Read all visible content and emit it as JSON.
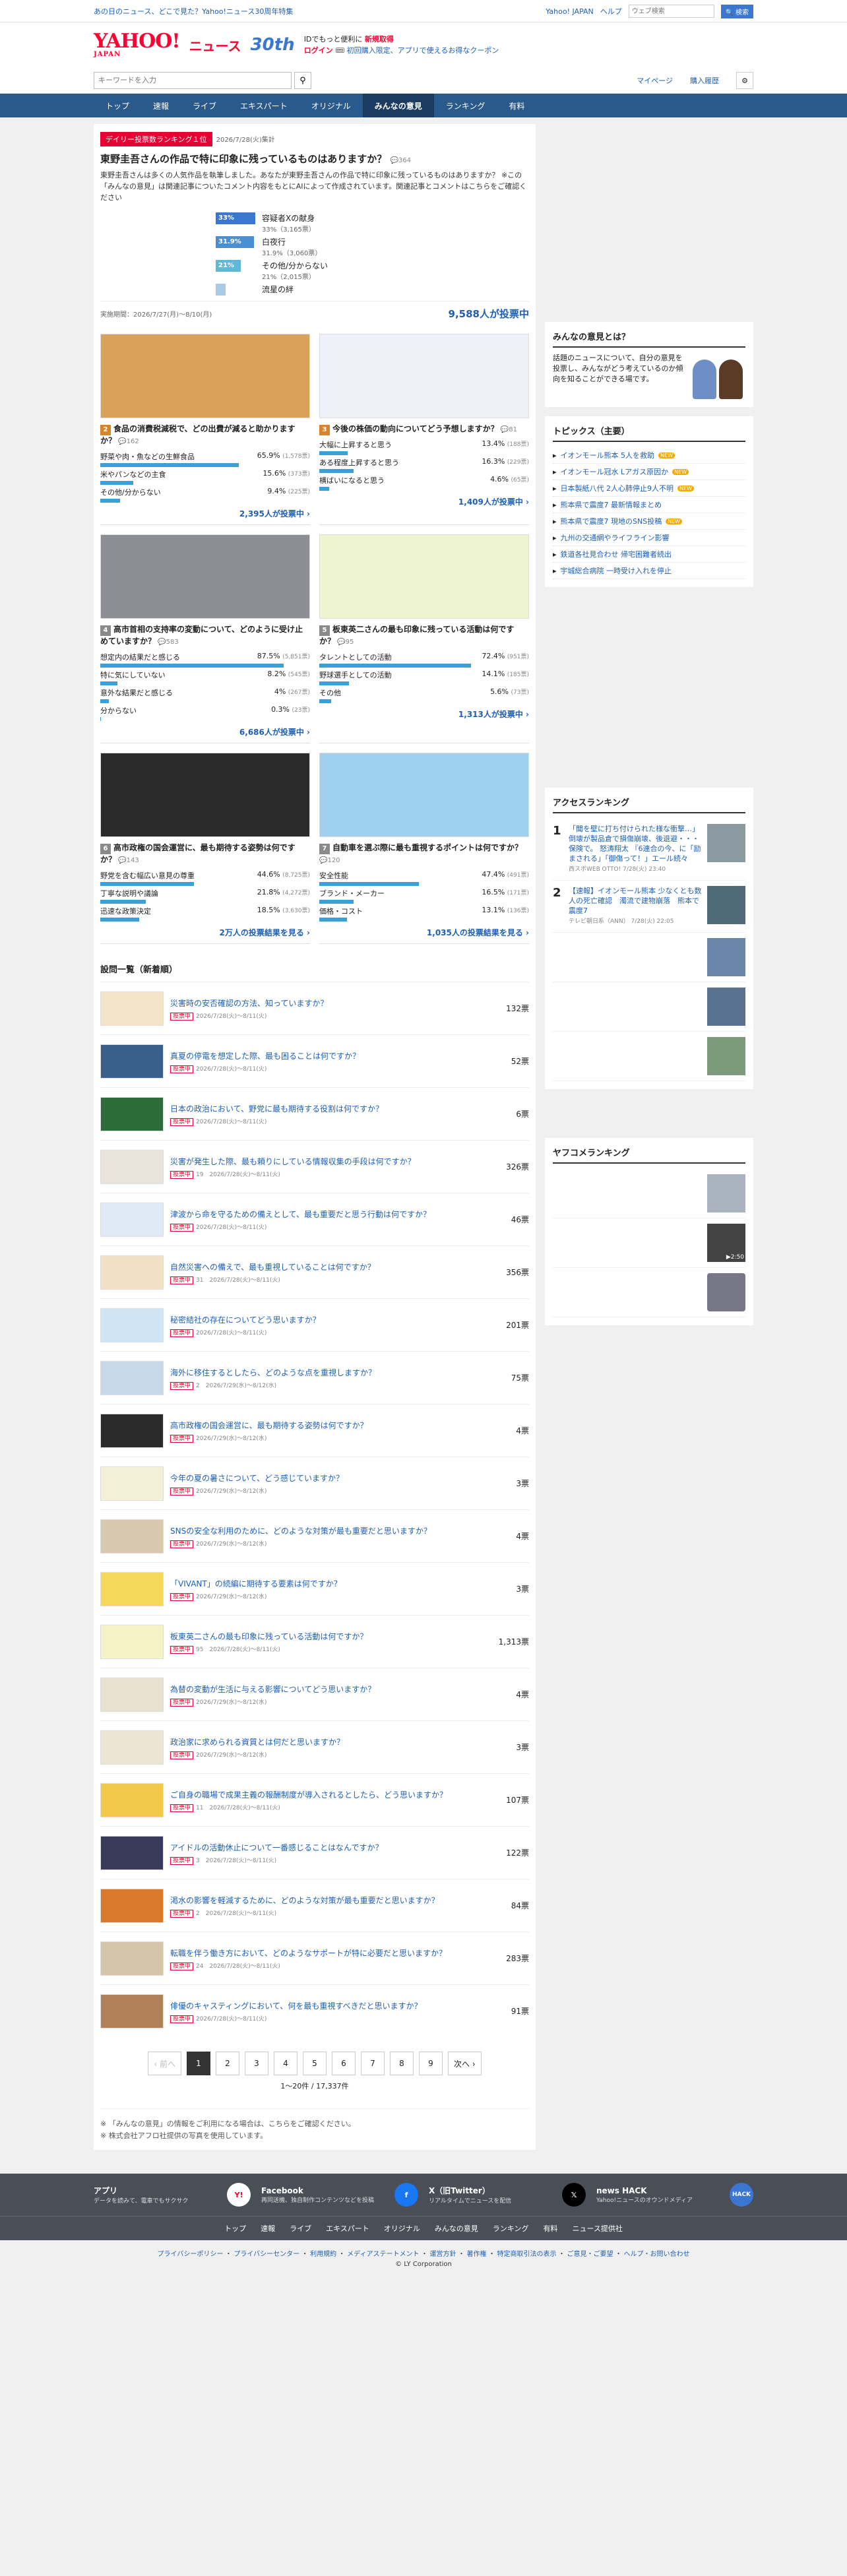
{
  "top": {
    "left": "あの日のニュース、どこで見た？Yahoo!ニュース30周年特集",
    "links": [
      "Yahoo! JAPAN",
      "ヘルプ"
    ],
    "search_placeholder": "ウェブ検索",
    "search_btn": "🔍 ~~検索~~"
  },
  "header": {
    "logo": "YAHOO!",
    "logo_sub": "JAPAN",
    "news": "ニュース",
    "badge": "30th",
    "promo1": "IDでもっと便利に",
    "promo1b": "新規取得",
    "promo2": "ログイン",
    "promo2b": "初回購入限定、アプリで使えるお得なクーポン"
  },
  "searchbar": {
    "placeholder": "キーワードを入力",
    "links": [
      "マイページ",
      "購入履歴"
    ]
  },
  "nav": [
    "トップ",
    "速報",
    "ライブ",
    "エキスパート",
    "オリジナル",
    "みんなの意見",
    "ランキング",
    "有料"
  ],
  "hero": {
    "tag": "デイリー投票数ランキング１位",
    "date": "2026/7/28(火)集計",
    "question": "東野圭吾さんの作品で特に印象に残っているものはありますか？",
    "comments": "364",
    "desc": "東野圭吾さんは多くの人気作品を執筆しました。あなたが東野圭吾さんの作品で特に印象に残っているものはありますか？ ※この「みんなの意見」は関連記事についたコメント内容をもとにAIによって作成されています。関連記事とコメントはこちらをご確認ください",
    "options": [
      {
        "pct": "33%",
        "label": "容疑者Xの献身",
        "sub": "33%（3,165票）",
        "w": 33
      },
      {
        "pct": "31.9%",
        "label": "白夜行",
        "sub": "31.9%（3,060票）",
        "w": 31.9
      },
      {
        "pct": "21%",
        "label": "その他/分からない",
        "sub": "21%（2,015票）",
        "w": 21
      },
      {
        "pct": "",
        "label": "流星の絆",
        "sub": "",
        "w": 8
      }
    ],
    "period": "実施期間：2026/7/27(月)〜8/10(月)",
    "votes": "9,588人が投票中"
  },
  "cards": [
    {
      "rank": "2",
      "q": "食品の消費税減税で、どの出費が減ると助かりますか？",
      "c": "162",
      "opts": [
        [
          "野菜や肉・魚などの生鮮食品",
          "65.9%",
          "1,578票",
          65.9
        ],
        [
          "米やパンなどの主食",
          "15.6%",
          "373票",
          15.6
        ],
        [
          "その他/分からない",
          "9.4%",
          "225票",
          9.4
        ]
      ],
      "foot": "2,395人が投票中"
    },
    {
      "rank": "3",
      "q": "今後の株価の動向についてどう予想しますか？",
      "c": "81",
      "opts": [
        [
          "大幅に上昇すると思う",
          "13.4%",
          "188票",
          13.4
        ],
        [
          "ある程度上昇すると思う",
          "16.3%",
          "229票",
          16.3
        ],
        [
          "横ばいになると思う",
          "4.6%",
          "65票",
          4.6
        ]
      ],
      "foot": "1,409人が投票中"
    },
    {
      "rank": "4",
      "q": "高市首相の支持率の変動について、どのように受け止めていますか？",
      "c": "583",
      "opts": [
        [
          "想定内の結果だと感じる",
          "87.5%",
          "5,851票",
          87.5
        ],
        [
          "特に気にしていない",
          "8.2%",
          "545票",
          8.2
        ],
        [
          "意外な結果だと感じる",
          "4%",
          "267票",
          4
        ],
        [
          "分からない",
          "0.3%",
          "23票",
          0.3
        ]
      ],
      "foot": "6,686人が投票中"
    },
    {
      "rank": "5",
      "q": "板東英二さんの最も印象に残っている活動は何ですか？",
      "c": "95",
      "opts": [
        [
          "タレントとしての活動",
          "72.4%",
          "951票",
          72.4
        ],
        [
          "野球選手としての活動",
          "14.1%",
          "185票",
          14.1
        ],
        [
          "その他",
          "5.6%",
          "73票",
          5.6
        ]
      ],
      "foot": "1,313人が投票中"
    },
    {
      "rank": "6",
      "q": "高市政権の国会運営に、最も期待する姿勢は何ですか？",
      "c": "143",
      "opts": [
        [
          "野党を含む幅広い意見の尊重",
          "44.6%",
          "8,725票",
          44.6
        ],
        [
          "丁寧な説明や議論",
          "21.8%",
          "4,272票",
          21.8
        ],
        [
          "迅速な政策決定",
          "18.5%",
          "3,630票",
          18.5
        ]
      ],
      "foot": "2万人の投票結果を見る"
    },
    {
      "rank": "7",
      "q": "自動車を選ぶ際に最も重視するポイントは何ですか？",
      "c": "120",
      "opts": [
        [
          "安全性能",
          "47.4%",
          "491票",
          47.4
        ],
        [
          "ブランド・メーカー",
          "16.5%",
          "171票",
          16.5
        ],
        [
          "価格・コスト",
          "13.1%",
          "136票",
          13.1
        ]
      ],
      "foot": "1,035人の投票結果を見る"
    }
  ],
  "list_title": "設問一覧（新着順）",
  "list": [
    {
      "q": "災害時の安否確認の方法、知っていますか？",
      "m": "2026/7/28(火)〜8/11(火)",
      "v": "132票"
    },
    {
      "q": "真夏の停電を想定した際、最も困ることは何ですか？",
      "m": "2026/7/28(火)〜8/11(火)",
      "v": "52票"
    },
    {
      "q": "日本の政治において、野党に最も期待する役割は何ですか？",
      "m": "2026/7/28(火)〜8/11(火)",
      "v": "6票"
    },
    {
      "q": "災害が発生した際、最も頼りにしている情報収集の手段は何ですか？",
      "m": "19　2026/7/28(火)〜8/11(火)",
      "v": "326票"
    },
    {
      "q": "津波から命を守るための備えとして、最も重要だと思う行動は何ですか？",
      "m": "2026/7/28(火)〜8/11(火)",
      "v": "46票"
    },
    {
      "q": "自然災害への備えで、最も重視していることは何ですか？",
      "m": "31　2026/7/28(火)〜8/11(火)",
      "v": "356票"
    },
    {
      "q": "秘密結社の存在についてどう思いますか？",
      "m": "2026/7/28(火)〜8/11(火)",
      "v": "201票"
    },
    {
      "q": "海外に移住するとしたら、どのような点を重視しますか？",
      "m": "2　2026/7/29(水)〜8/12(水)",
      "v": "75票"
    },
    {
      "q": "高市政権の国会運営に、最も期待する姿勢は何ですか？",
      "m": "2026/7/29(水)〜8/12(水)",
      "v": "4票"
    },
    {
      "q": "今年の夏の暑さについて、どう感じていますか？",
      "m": "2026/7/29(水)〜8/12(水)",
      "v": "3票"
    },
    {
      "q": "SNSの安全な利用のために、どのような対策が最も重要だと思いますか？",
      "m": "2026/7/29(水)〜8/12(水)",
      "v": "4票"
    },
    {
      "q": "「VIVANT」の続編に期待する要素は何ですか？",
      "m": "2026/7/29(水)〜8/12(水)",
      "v": "3票"
    },
    {
      "q": "板東英二さんの最も印象に残っている活動は何ですか？",
      "m": "95　2026/7/28(火)〜8/11(火)",
      "v": "1,313票"
    },
    {
      "q": "為替の変動が生活に与える影響についてどう思いますか？",
      "m": "2026/7/29(水)〜8/12(水)",
      "v": "4票"
    },
    {
      "q": "政治家に求められる資質とは何だと思いますか？",
      "m": "2026/7/29(水)〜8/12(水)",
      "v": "3票"
    },
    {
      "q": "ご自身の職場で成果主義の報酬制度が導入されるとしたら、どう思いますか？",
      "m": "11　2026/7/28(火)〜8/11(火)",
      "v": "107票"
    },
    {
      "q": "アイドルの活動休止について一番感じることはなんですか？",
      "m": "3　2026/7/28(火)〜8/11(火)",
      "v": "122票"
    },
    {
      "q": "渇水の影響を軽減するために、どのような対策が最も重要だと思いますか？",
      "m": "2　2026/7/28(火)〜8/11(火)",
      "v": "84票"
    },
    {
      "q": "転職を伴う働き方において、どのようなサポートが特に必要だと思いますか？",
      "m": "24　2026/7/28(火)〜8/11(火)",
      "v": "283票"
    },
    {
      "q": "俳優のキャスティングにおいて、何を最も重視すべきだと思いますか？",
      "m": "2026/7/28(火)〜8/11(火)",
      "v": "91票"
    }
  ],
  "badge": "投票中",
  "pager": {
    "prev": "‹ 前へ",
    "pages": [
      "1",
      "2",
      "3",
      "4",
      "5",
      "6",
      "7",
      "8",
      "9"
    ],
    "next": "次へ ›",
    "range": "1〜20件 / 17,337件"
  },
  "notes": [
    "「みんなの意見」の情報をご利用になる場合は、こちらをご確認ください。",
    "株式会社アフロ社提供の写真を使用しています。"
  ],
  "side": {
    "about_title": "みんなの意見とは？",
    "about_text": "話題のニュースについて、自分の意見を投票し、みんながどう考えているのか傾向を知ることができる場です。",
    "topics_title": "トピックス（主要）",
    "topics": [
      "イオンモール熊本 5人を救助",
      "イオンモール冠水 Lアガス原因か",
      "日本製紙八代 2人心肺停止9人不明",
      "熊本県で震度7 最新情報まとめ",
      "熊本県で震度7 現地のSNS投稿",
      "九州の交通網やライフライン影響",
      "鉄道各社見合わせ 帰宅困難者続出",
      "宇城総合病院 一時受け入れを停止"
    ],
    "access_title": "アクセスランキング",
    "access": [
      {
        "n": "1",
        "t": "「聞を壁に打ち付けられた様な衝撃…」 倒壊が製品倉で損傷崩壊、後退避・・・保険で。 怒涛翔太 『6連合の今、に「励まされる」「御傷って！」エール続々",
        "s": "西スポWEB OTTO! 7/28(火) 23:40"
      },
      {
        "n": "2",
        "t": "【速報】イオンモール熊本 少なくとも数人の死亡確認　濁流で建物崩落　熊本で震度7",
        "s": "テレビ朝日系（ANN） 7/28(火) 22:05"
      }
    ],
    "yafuoku_title": "ヤフコメランキング",
    "play": "2:50"
  },
  "footer": {
    "cols": [
      {
        "t": "アプリ",
        "d": "データを読みて、電車でもサクサク"
      },
      {
        "t": "Facebook",
        "d": "再同送機、独自制作コンテンツなどを投稿"
      },
      {
        "t": "X（旧Twitter）",
        "d": "リアルタイムでニュースを配信"
      },
      {
        "t": "news HACK",
        "d": "Yahoo!ニュースのオウンドメディア"
      }
    ],
    "nav": [
      "トップ",
      "速報",
      "ライブ",
      "エキスパート",
      "オリジナル",
      "みんなの意見",
      "ランキング",
      "有料",
      "ニュース提供社"
    ],
    "legal": [
      "プライバシーポリシー",
      "プライバシーセンター",
      "利用規約",
      "メディアステートメント",
      "運営方針",
      "著作権",
      "特定商取引法の表示",
      "ご意見・ご要望",
      "ヘルプ・お問い合わせ"
    ],
    "copy": "© LY Corporation"
  }
}
